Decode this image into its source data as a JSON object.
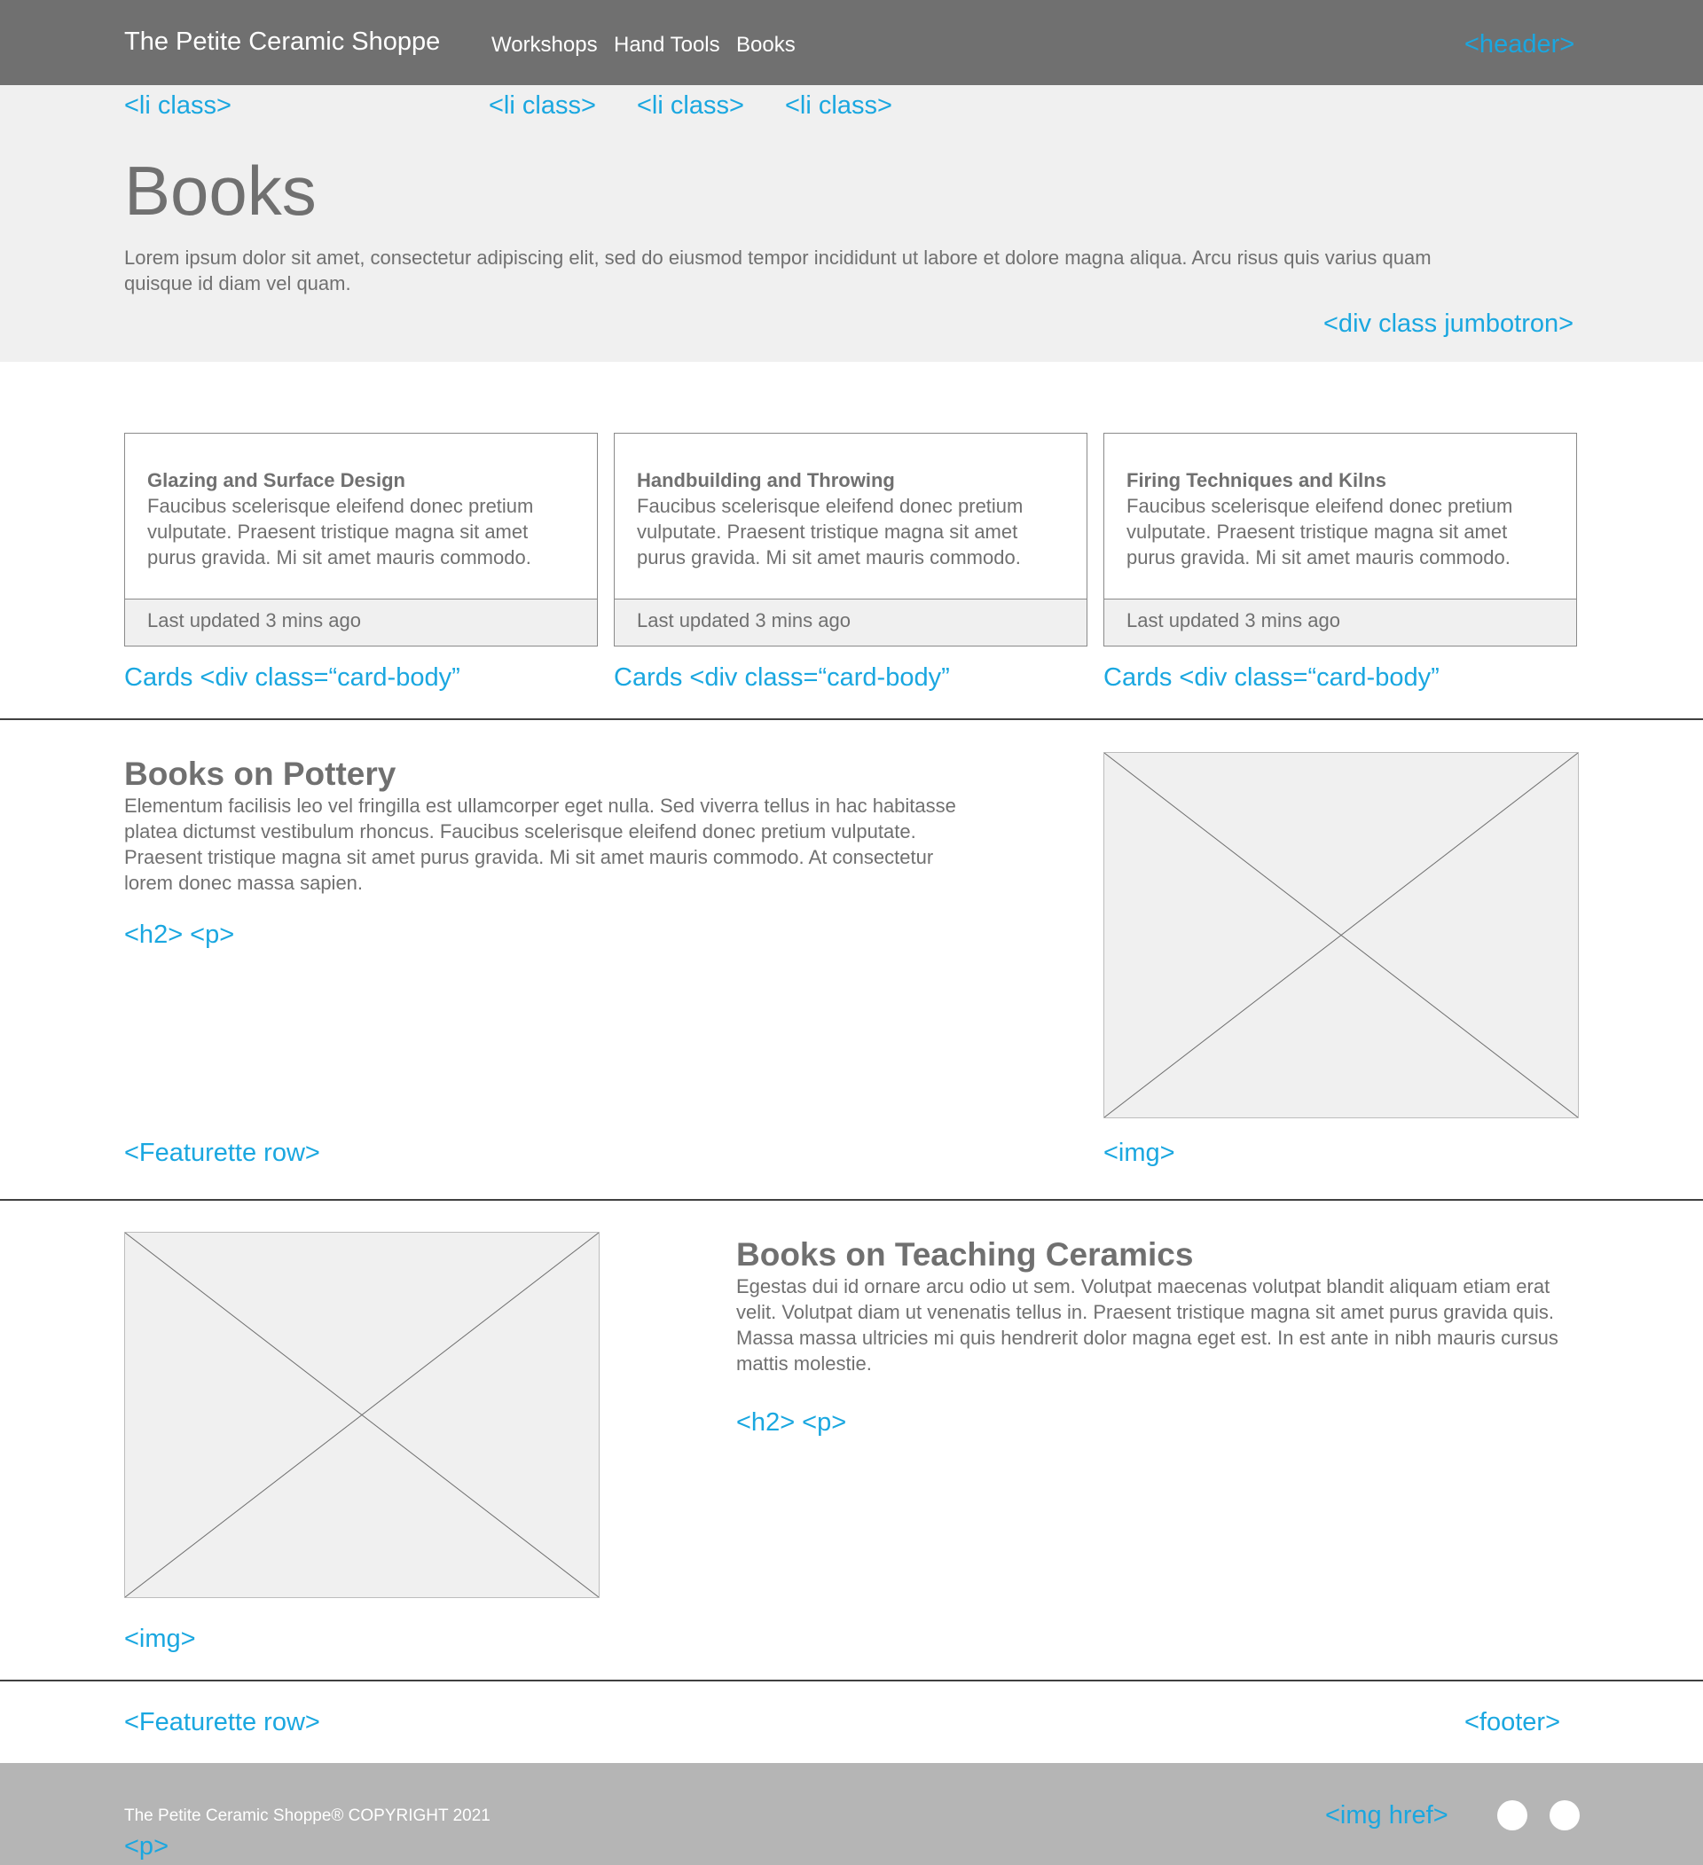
{
  "header": {
    "brand": "The Petite Ceramic Shoppe",
    "nav": [
      "Workshops",
      "Hand Tools",
      "Books"
    ]
  },
  "annotations": {
    "header": "<header>",
    "li": "<li class>",
    "jumbotron": "<div class jumbotron>",
    "cards": "Cards <div class=“card-body”",
    "h2p": "<h2> <p>",
    "featurette_row": "<Featurette row>",
    "img": "<img>",
    "footer": "<footer>",
    "img_href": "<img href>",
    "p": "<p>"
  },
  "jumbotron": {
    "title": "Books",
    "lead": "Lorem ipsum dolor sit amet, consectetur adipiscing elit, sed do eiusmod tempor incididunt ut labore et dolore magna aliqua. Arcu risus quis varius quam quisque id diam vel quam."
  },
  "cards": [
    {
      "title": "Glazing and Surface Design",
      "text": "Faucibus scelerisque eleifend donec pretium vulputate. Praesent tristique magna sit amet purus gravida. Mi sit amet mauris commodo.",
      "footer": "Last updated 3 mins ago"
    },
    {
      "title": "Handbuilding and Throwing",
      "text": "Faucibus scelerisque eleifend donec pretium vulputate. Praesent tristique magna sit amet purus gravida. Mi sit amet mauris commodo.",
      "footer": "Last updated 3 mins ago"
    },
    {
      "title": "Firing Techniques and Kilns",
      "text": "Faucibus scelerisque eleifend donec pretium vulputate. Praesent tristique magna sit amet purus gravida. Mi sit amet mauris commodo.",
      "footer": "Last updated 3 mins ago"
    }
  ],
  "featurettes": [
    {
      "heading": "Books on Pottery",
      "text": "Elementum facilisis leo vel fringilla est ullamcorper eget nulla. Sed viverra tellus in hac habitasse platea dictumst vestibulum rhoncus. Faucibus scelerisque eleifend donec pretium vulputate. Praesent tristique magna sit amet purus gravida. Mi sit amet mauris commodo. At consectetur lorem donec massa sapien."
    },
    {
      "heading": "Books on Teaching Ceramics",
      "text": "Egestas dui id ornare arcu odio ut sem. Volutpat maecenas volutpat blandit aliquam etiam erat velit. Volutpat diam ut venenatis tellus in. Praesent tristique magna sit amet purus gravida quis. Massa massa ultricies mi quis hendrerit dolor magna eget est. In est ante in nibh mauris cursus mattis molestie."
    }
  ],
  "footer": {
    "copyright": "The Petite Ceramic Shoppe® COPYRIGHT 2021"
  },
  "colors": {
    "header_bg": "#707070",
    "jumbotron_bg": "#f0f0f0",
    "footer_bg": "#b5b5b5",
    "annotation": "#1aa7e0",
    "text": "#707070"
  }
}
